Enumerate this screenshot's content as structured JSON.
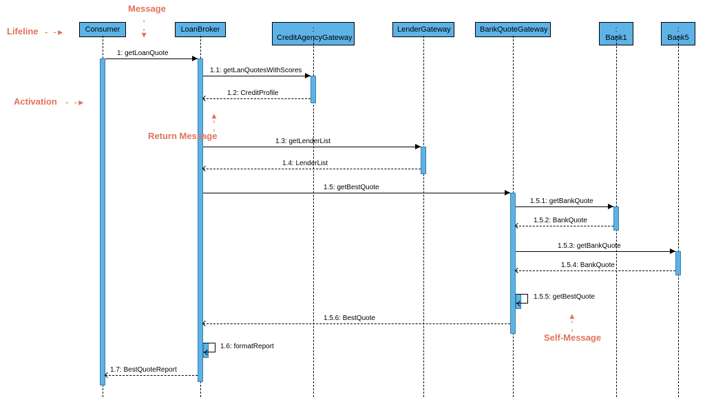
{
  "participants": {
    "consumer": "Consumer",
    "loanbroker": "LoanBroker",
    "creditagency": ": CreditAgencyGateway",
    "lendergateway": "LenderGateway",
    "bankquotegateway": "BankQuoteGateway",
    "bank1": ": Bank1",
    "bank5": ": Bank5"
  },
  "messages": {
    "m1": "1: getLoanQuote",
    "m1_1": "1.1: getLanQuotesWithScores",
    "m1_2": "1.2: CreditProfile",
    "m1_3": "1.3: getLenderList",
    "m1_4": "1.4: LenderList",
    "m1_5": "1.5: getBestQuote",
    "m1_5_1": "1.5.1: getBankQuote",
    "m1_5_2": "1.5.2: BankQuote",
    "m1_5_3": "1.5.3: getBankQuote",
    "m1_5_4": "1.5.4: BankQuote",
    "m1_5_5": "1.5.5: getBestQuote",
    "m1_5_6": "1.5.6: BestQuote",
    "m1_6": "1.6: formatReport",
    "m1_7": "1.7: BestQuoteReport"
  },
  "annotations": {
    "lifeline": "Lifeline",
    "message": "Message",
    "activation": "Activation",
    "return_message": "Return Message",
    "self_message": "Self-Message"
  }
}
